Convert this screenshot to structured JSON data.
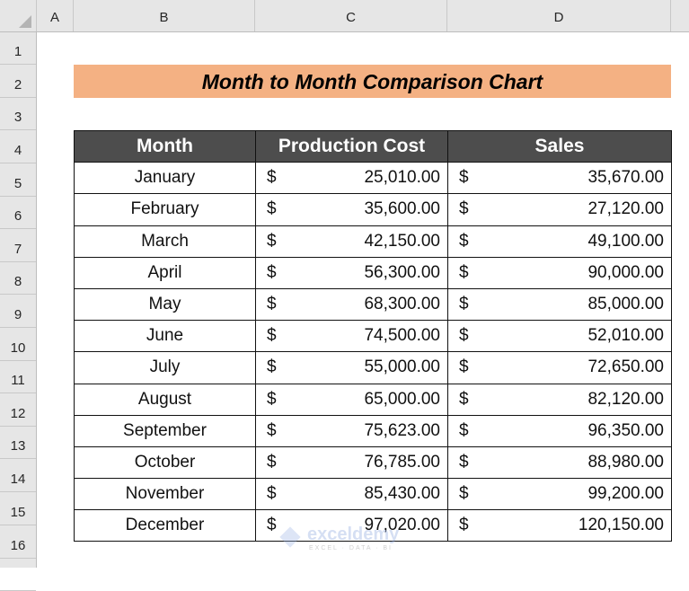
{
  "spreadsheet": {
    "columns": [
      "A",
      "B",
      "C",
      "D"
    ],
    "rows": [
      "1",
      "2",
      "3",
      "4",
      "5",
      "6",
      "7",
      "8",
      "9",
      "10",
      "11",
      "12",
      "13",
      "14",
      "15",
      "16"
    ]
  },
  "title": "Month to Month Comparison Chart",
  "table": {
    "headers": [
      "Month",
      "Production Cost",
      "Sales"
    ],
    "currency_symbol": "$",
    "rows": [
      {
        "month": "January",
        "cost": "25,010.00",
        "sales": "35,670.00"
      },
      {
        "month": "February",
        "cost": "35,600.00",
        "sales": "27,120.00"
      },
      {
        "month": "March",
        "cost": "42,150.00",
        "sales": "49,100.00"
      },
      {
        "month": "April",
        "cost": "56,300.00",
        "sales": "90,000.00"
      },
      {
        "month": "May",
        "cost": "68,300.00",
        "sales": "85,000.00"
      },
      {
        "month": "June",
        "cost": "74,500.00",
        "sales": "52,010.00"
      },
      {
        "month": "July",
        "cost": "55,000.00",
        "sales": "72,650.00"
      },
      {
        "month": "August",
        "cost": "65,000.00",
        "sales": "82,120.00"
      },
      {
        "month": "September",
        "cost": "75,623.00",
        "sales": "96,350.00"
      },
      {
        "month": "October",
        "cost": "76,785.00",
        "sales": "88,980.00"
      },
      {
        "month": "November",
        "cost": "85,430.00",
        "sales": "99,200.00"
      },
      {
        "month": "December",
        "cost": "97,020.00",
        "sales": "120,150.00"
      }
    ]
  },
  "colors": {
    "title_fill": "#f4b183",
    "header_fill": "#4d4d4d",
    "header_text": "#ffffff"
  },
  "watermark": {
    "brand": "exceldemy",
    "tagline": "EXCEL · DATA · BI"
  }
}
